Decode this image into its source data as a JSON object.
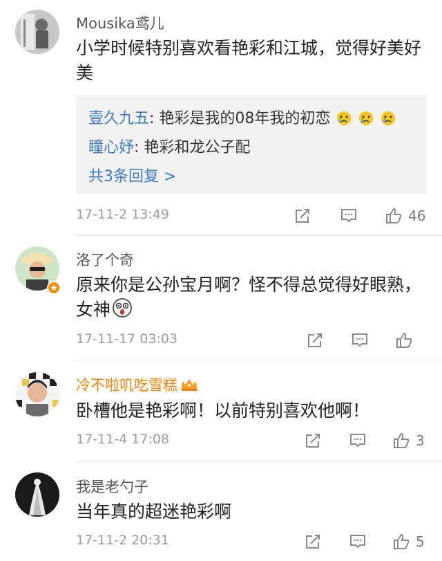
{
  "comments": [
    {
      "user": "Mousika鸢儿",
      "text": "小学时候特别喜欢看艳彩和江城，觉得好美好美",
      "replies": [
        {
          "user": "壹久九五",
          "text": ": 艳彩是我的08年我的初恋"
        },
        {
          "user": "瞳心妤",
          "text": ": 艳彩和龙公子配"
        }
      ],
      "more_replies": "共3条回复 >",
      "time": "17-11-2 13:49",
      "likes": "46"
    },
    {
      "user": "洛了个奇",
      "text": "原来你是公孙宝月啊？怪不得总觉得好眼熟，女神",
      "time": "17-11-17 03:03",
      "likes": ""
    },
    {
      "user": "冷不啦叽吃雪糕",
      "text": "卧槽他是艳彩啊！以前特别喜欢他啊！",
      "time": "17-11-4 17:08",
      "likes": "3"
    },
    {
      "user": "我是老勺子",
      "text": "当年真的超迷艳彩啊",
      "time": "17-11-2 20:31",
      "likes": "5"
    }
  ],
  "icons": {
    "repost": "repost-icon",
    "comment": "comment-icon",
    "like": "thumbs-up-icon",
    "badge": "verified-badge-icon",
    "crown": "crown-icon"
  },
  "colors": {
    "link_blue": "#3d7cc9",
    "vip_orange": "#ff8200",
    "time_gray": "#9b9b9b",
    "reply_bg": "#f2f2f2"
  }
}
